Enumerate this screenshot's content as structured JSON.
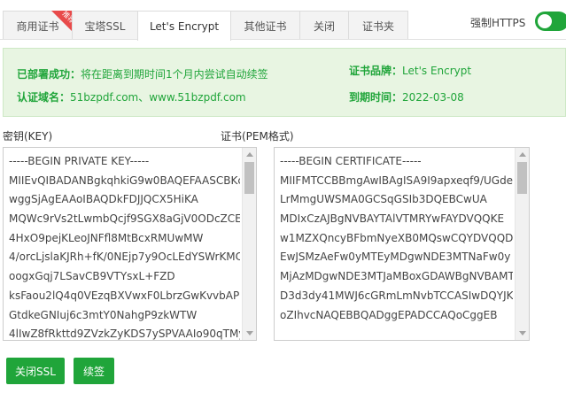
{
  "tabs": [
    {
      "label": "商用证书",
      "active": false,
      "badge": "推荐"
    },
    {
      "label": "宝塔SSL",
      "active": false
    },
    {
      "label": "Let's Encrypt",
      "active": true
    },
    {
      "label": "其他证书",
      "active": false
    },
    {
      "label": "关闭",
      "active": false
    },
    {
      "label": "证书夹",
      "active": false
    }
  ],
  "force_https": {
    "label": "强制HTTPS",
    "enabled": true
  },
  "info": {
    "status_key": "已部署成功：",
    "status_value": "将在距离到期时间1个月内尝试自动续签",
    "domain_key": "认证域名：",
    "domain_value": "51bzpdf.com、www.51bzpdf.com",
    "brand_key": "证书品牌：",
    "brand_value": "Let's Encrypt",
    "expire_key": "到期时间：",
    "expire_value": "2022-03-08"
  },
  "key": {
    "label": "密钥(KEY)",
    "lines": [
      "-----BEGIN PRIVATE KEY-----",
      "MIIEvQIBADANBgkqhkiG9w0BAQEFAASCBKc",
      "wggSjAgEAAoIBAQDkFDJJQCX5HiKA",
      "MQWc9rVs2tLwmbQcjf9SGX8aGjV0ODcZCE+",
      "4HxO9pejKLeoJNFfl8MtBcxRMUwMW",
      "4/orcLjslaKJRh+fK/0NEjp7y9OcLEdYSWrKMC",
      "oogxGqj7LSavCB9VTYsxL+FZD",
      "ksFaou2lQ4q0VEzqBXVwxF0LbrzGwKvvbAPE",
      "GtdkeGNIuj6c3mtY0NahgP9zkWTW",
      "4lIwZ8fRkttd9ZVzkZyKDS7ySPVAAIo90qTMy"
    ]
  },
  "cert": {
    "label": "证书(PEM格式)",
    "lines": [
      "-----BEGIN CERTIFICATE-----",
      "MIIFMTCCBBmgAwIBAgISA9I9apxeqf9/UGde",
      "LrMmgUWSMA0GCSqGSIb3DQEBCwUA",
      "MDIxCzAJBgNVBAYTAlVTMRYwFAYDVQQKE",
      "w1MZXQncyBFbmNyeXB0MQswCQYDVQQD",
      "EwJSMzAeFw0yMTEyMDgwNDE3MTNaFw0y",
      "MjAzMDgwNDE3MTJaMBoxGDAWBgNVBAMT",
      "D3d3dy41MWJ6cGRmLmNvbTCCASIwDQYJK",
      "oZIhvcNAQEBBQADggEPADCCAQoCggEB"
    ]
  },
  "buttons": {
    "close_ssl": "关闭SSL",
    "renew": "续签"
  },
  "colors": {
    "accent": "#20a53a",
    "info_bg": "#e8f5e2",
    "badge": "#e84a4a"
  }
}
